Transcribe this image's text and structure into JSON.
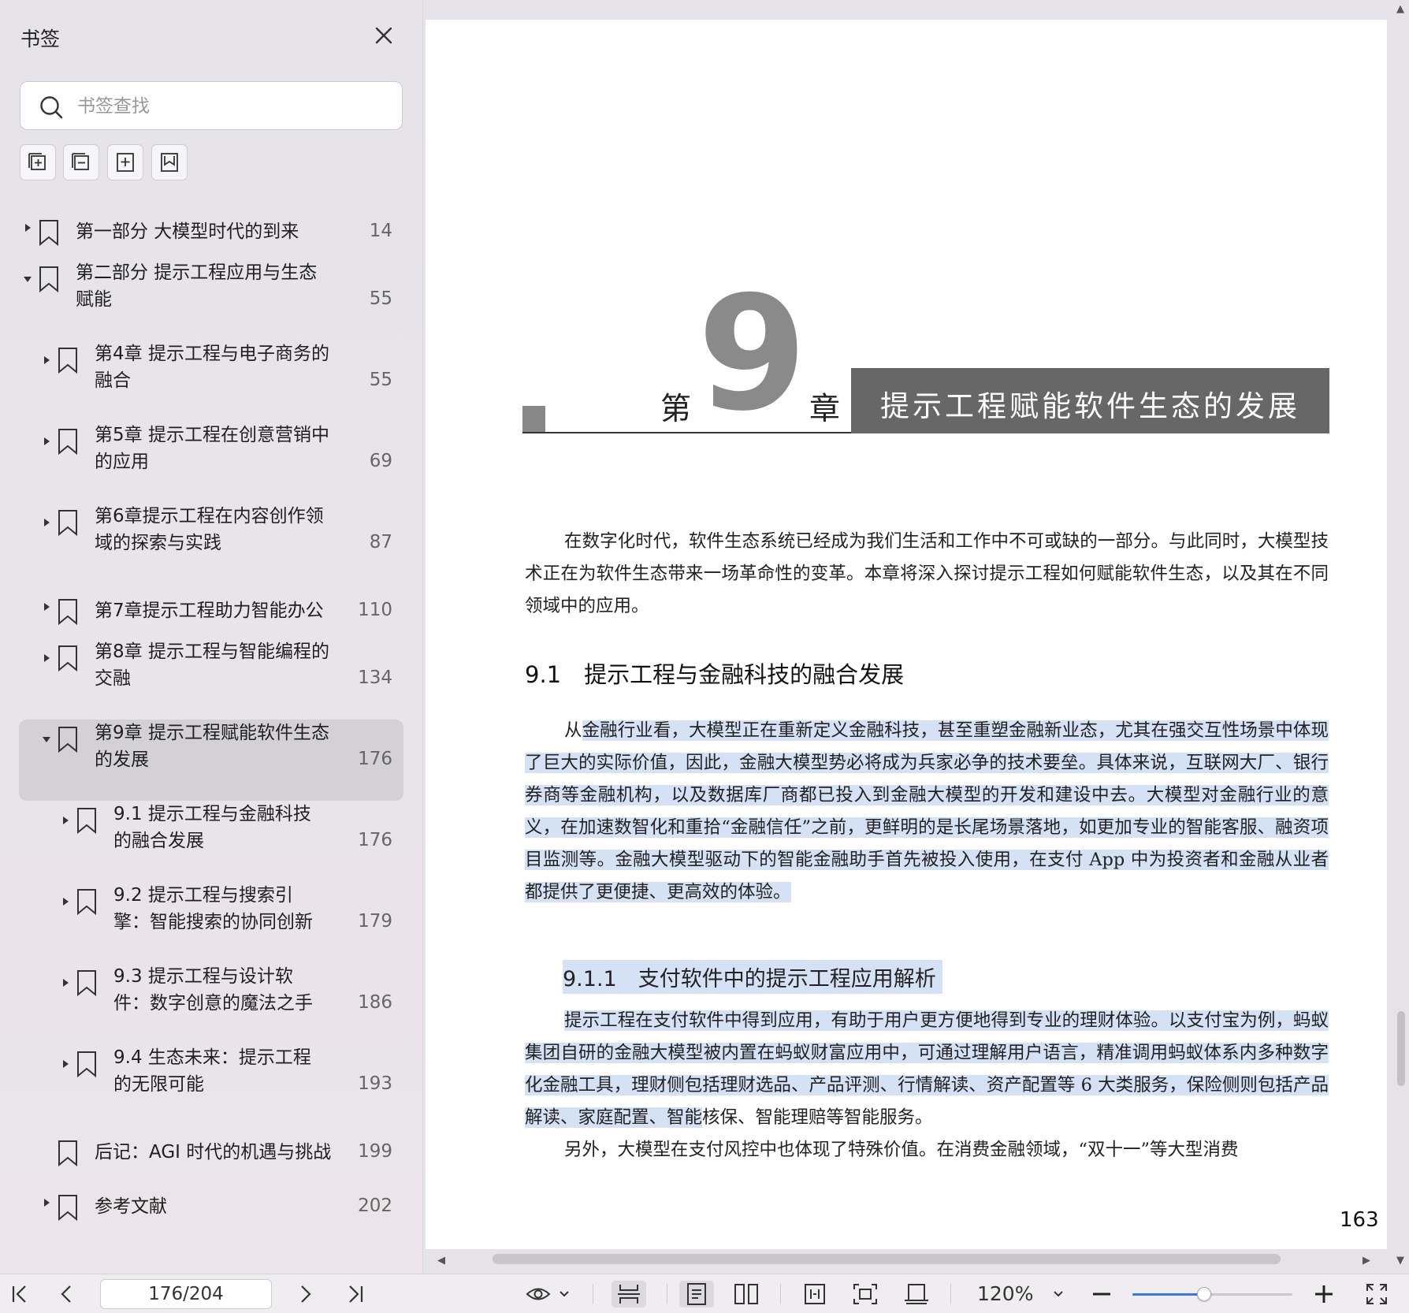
{
  "sidebar": {
    "title": "书签",
    "search_placeholder": "书签查找",
    "tools": [
      "add-bookmark-icon",
      "remove-bookmark-icon",
      "expand-bookmark-icon",
      "bookmark-icon"
    ],
    "items": [
      {
        "label": "第一部分 大模型时代的到来",
        "page": "14",
        "level": 0,
        "expanded": false,
        "has_children": true
      },
      {
        "label": "第二部分 提示工程应用与生态赋能",
        "page": "55",
        "level": 0,
        "expanded": true,
        "has_children": true
      },
      {
        "label": "第4章 提示工程与电子商务的融合",
        "page": "55",
        "level": 1,
        "expanded": false,
        "has_children": true
      },
      {
        "label": "第5章 提示工程在创意营销中的应用",
        "page": "69",
        "level": 1,
        "expanded": false,
        "has_children": true
      },
      {
        "label": "第6章提示工程在内容创作领域的探索与实践",
        "page": "87",
        "level": 1,
        "expanded": false,
        "has_children": true
      },
      {
        "label": "第7章提示工程助力智能办公",
        "page": "110",
        "level": 1,
        "expanded": false,
        "has_children": true
      },
      {
        "label": "第8章 提示工程与智能编程的交融",
        "page": "134",
        "level": 1,
        "expanded": false,
        "has_children": true
      },
      {
        "label": "第9章 提示工程赋能软件生态的发展",
        "page": "176",
        "level": 1,
        "expanded": true,
        "has_children": true,
        "selected": true
      },
      {
        "label": "9.1 提示工程与金融科技的融合发展",
        "page": "176",
        "level": 2,
        "expanded": false,
        "has_children": true
      },
      {
        "label": "9.2 提示工程与搜索引擎：智能搜索的协同创新",
        "page": "179",
        "level": 2,
        "expanded": false,
        "has_children": true
      },
      {
        "label": "9.3 提示工程与设计软件：数字创意的魔法之手",
        "page": "186",
        "level": 2,
        "expanded": false,
        "has_children": true
      },
      {
        "label": "9.4 生态未来：提示工程的无限可能",
        "page": "193",
        "level": 2,
        "expanded": false,
        "has_children": true
      },
      {
        "label": "后记：AGI 时代的机遇与挑战",
        "page": "199",
        "level": 1,
        "expanded": false,
        "has_children": false
      },
      {
        "label": "参考文献",
        "page": "202",
        "level": 1,
        "expanded": false,
        "has_children": true
      }
    ]
  },
  "document": {
    "chapter_prefix": "第",
    "chapter_number": "9",
    "chapter_suffix": "章",
    "chapter_title": "提示工程赋能软件生态的发展",
    "intro": "在数字化时代，软件生态系统已经成为我们生活和工作中不可或缺的一部分。与此同时，大模型技术正在为软件生态带来一场革命性的变革。本章将深入探讨提示工程如何赋能软件生态，以及其在不同领域中的应用。",
    "section_91": "9.1　提示工程与金融科技的融合发展",
    "p1_lead": "从",
    "p1_hl": "金融行业看，大模型正在重新定义金融科技，甚至重塑金融新业态，尤其在强交互性场景中体现了巨大的实际价值，因此，金融大模型势必将成为兵家必争的技术要垒。具体来说，互联网大厂、银行券商等金融机构，以及数据库厂商都已投入到金融大模型的开发和建设中去。大模型对金融行业的意义，在加速数智化和重拾“金融信任”之前，更鲜明的是长尾场景落地，如更加专业的智能客服、融资项目监测等。金融大模型驱动下的智能金融助手首先被投入使用，在支付 App 中为投资者和金融从业者都提供了更便捷、更高效的体验。",
    "section_911": "9.1.1　支付软件中的提示工程应用解析",
    "p2_hl": "提示工程在支付软件中得到应用，有助于用户更方便地得到专业的理财体验。以支付宝为例，蚂蚁集团自研的金融大模型被内置在蚂蚁财富应用中，可通过理解用户语言，精准调用蚂蚁体系内多种数字化金融工具，理财侧包括理财选品、产品评测、行情解读、资产配置等 6 大类服务，保险侧则包括产品解读、家庭配置、智能",
    "p2_rest": "核保、智能理赔等智能服务。",
    "p3": "另外，大模型在支付风控中也体现了特殊价值。在消费金融领域，“双十一”等大型消费",
    "page_number": "163"
  },
  "toolbar": {
    "page_indicator": "176/204",
    "zoom": "120%",
    "zoom_fraction": 0.45,
    "accent": "#3a78d8"
  }
}
